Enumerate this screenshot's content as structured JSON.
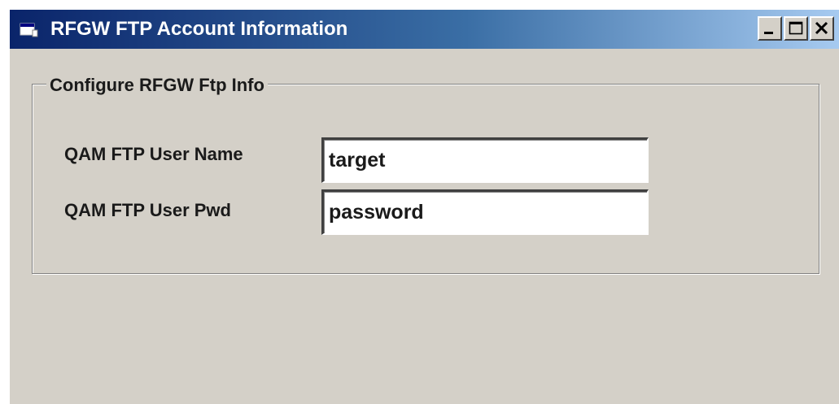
{
  "window": {
    "title": "RFGW FTP Account Information",
    "icon": "app-window-icon",
    "controls": {
      "minimize_icon": "minimize-icon",
      "maximize_icon": "maximize-icon",
      "close_icon": "close-icon"
    },
    "title_gradient": [
      "#0a246a",
      "#3a6ea5",
      "#a6caf0"
    ],
    "face_color": "#d4d0c8"
  },
  "group": {
    "legend": "Configure RFGW Ftp Info",
    "fields": [
      {
        "label": "QAM FTP User Name",
        "value": "target"
      },
      {
        "label": "QAM FTP User Pwd",
        "value": "password"
      }
    ]
  }
}
